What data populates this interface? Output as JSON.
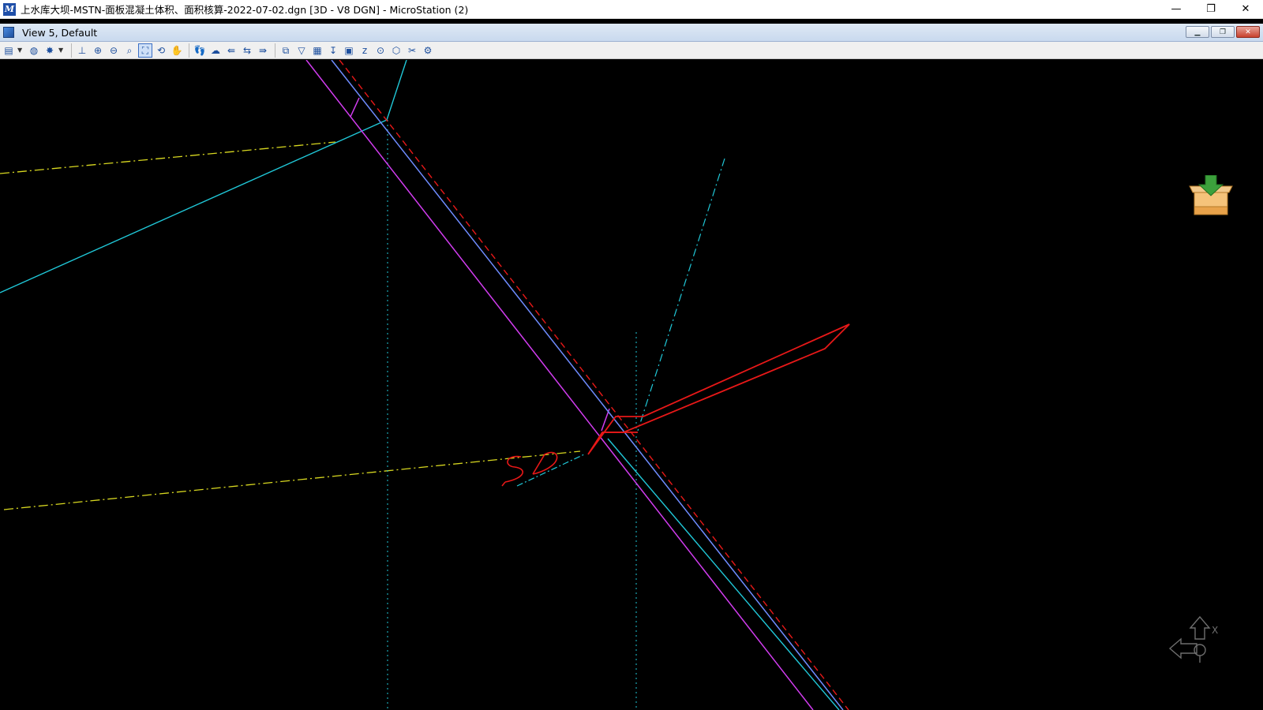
{
  "window": {
    "title": "上水库大坝-MSTN-面板混凝土体积、面积核算-2022-07-02.dgn [3D - V8 DGN] - MicroStation (2)",
    "minimize_glyph": "—",
    "maximize_glyph": "❐",
    "close_glyph": "✕"
  },
  "view": {
    "title": "View 5, Default"
  },
  "drawing": {
    "handwritten_annotation": "SD"
  },
  "view_rotation": {
    "axis_label": "X"
  },
  "colors": {
    "background": "#000000",
    "magenta": "#d23cf0",
    "blue": "#6f8cff",
    "cyan": "#20c8d8",
    "red": "#e81818",
    "yellow": "#d8d820"
  }
}
